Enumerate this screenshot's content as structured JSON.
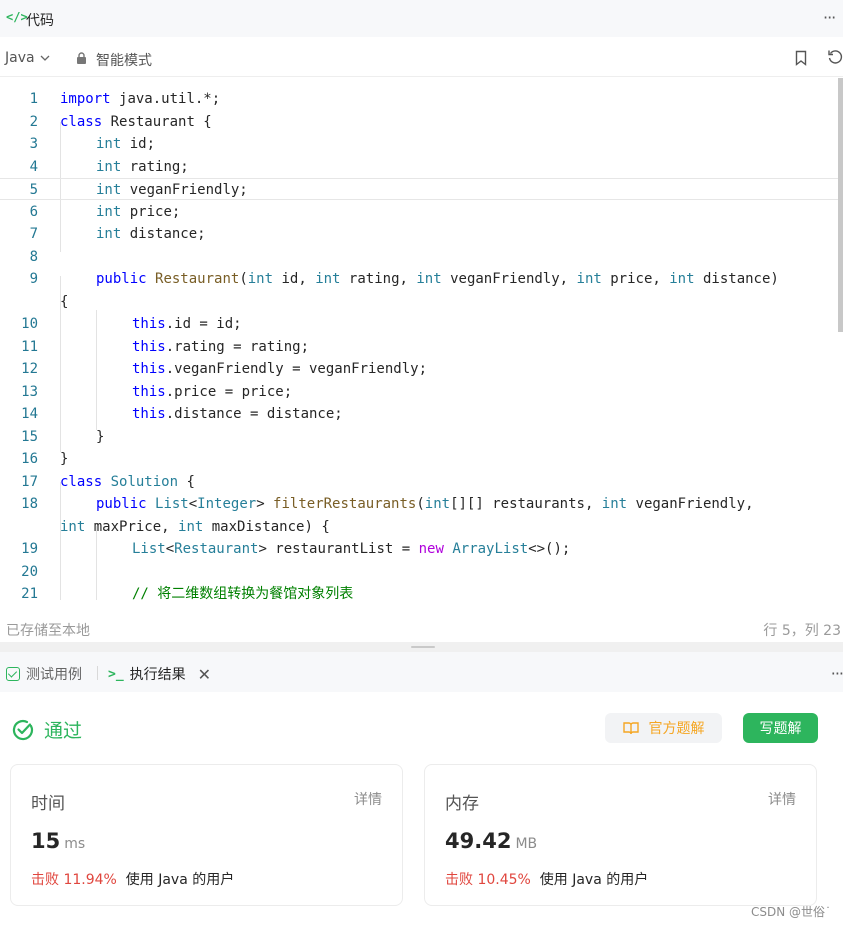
{
  "header": {
    "tab_icon": "</>",
    "tab_label": "代码",
    "more": "···"
  },
  "toolbar": {
    "language": "Java",
    "mode": "智能模式"
  },
  "code": {
    "lines": [
      {
        "n": "1",
        "indent": 0,
        "parts": [
          [
            "kw",
            "import"
          ],
          [
            "",
            "java.util.*;"
          ]
        ]
      },
      {
        "n": "2",
        "indent": 0,
        "parts": [
          [
            "kw",
            "class"
          ],
          [
            "",
            "Restaurant {"
          ]
        ]
      },
      {
        "n": "3",
        "indent": 1,
        "parts": [
          [
            "kt",
            "int"
          ],
          [
            "",
            " id;"
          ]
        ]
      },
      {
        "n": "4",
        "indent": 1,
        "parts": [
          [
            "kt",
            "int"
          ],
          [
            "",
            " rating;"
          ]
        ]
      },
      {
        "n": "5",
        "indent": 1,
        "parts": [
          [
            "kt",
            "int"
          ],
          [
            "",
            " veganFriendly;"
          ]
        ]
      },
      {
        "n": "6",
        "indent": 1,
        "parts": [
          [
            "kt",
            "int"
          ],
          [
            "",
            " price;"
          ]
        ]
      },
      {
        "n": "7",
        "indent": 1,
        "parts": [
          [
            "kt",
            "int"
          ],
          [
            "",
            " distance;"
          ]
        ]
      },
      {
        "n": "8",
        "indent": 0,
        "parts": []
      },
      {
        "n": "9",
        "indent": 1,
        "parts": [
          [
            "kw",
            "public"
          ],
          [
            "",
            " "
          ],
          [
            "fn",
            "Restaurant"
          ],
          [
            "",
            "("
          ],
          [
            "kt",
            "int"
          ],
          [
            "",
            " id, "
          ],
          [
            "kt",
            "int"
          ],
          [
            "",
            " rating, "
          ],
          [
            "kt",
            "int"
          ],
          [
            "",
            " veganFriendly, "
          ],
          [
            "kt",
            "int"
          ],
          [
            "",
            " price, "
          ],
          [
            "kt",
            "int"
          ],
          [
            "",
            " distance)"
          ]
        ]
      },
      {
        "n": "",
        "indent": 0,
        "parts": [
          [
            "",
            "{"
          ]
        ]
      },
      {
        "n": "10",
        "indent": 2,
        "parts": [
          [
            "kw",
            "this"
          ],
          [
            "",
            ".id = id;"
          ]
        ]
      },
      {
        "n": "11",
        "indent": 2,
        "parts": [
          [
            "kw",
            "this"
          ],
          [
            "",
            ".rating = rating;"
          ]
        ]
      },
      {
        "n": "12",
        "indent": 2,
        "parts": [
          [
            "kw",
            "this"
          ],
          [
            "",
            ".veganFriendly = veganFriendly;"
          ]
        ]
      },
      {
        "n": "13",
        "indent": 2,
        "parts": [
          [
            "kw",
            "this"
          ],
          [
            "",
            ".price = price;"
          ]
        ]
      },
      {
        "n": "14",
        "indent": 2,
        "parts": [
          [
            "kw",
            "this"
          ],
          [
            "",
            ".distance = distance;"
          ]
        ]
      },
      {
        "n": "15",
        "indent": 1,
        "parts": [
          [
            "",
            "}"
          ]
        ]
      },
      {
        "n": "16",
        "indent": 0,
        "parts": [
          [
            "",
            "}"
          ]
        ]
      },
      {
        "n": "17",
        "indent": 0,
        "parts": [
          [
            "kw",
            "class"
          ],
          [
            "",
            " "
          ],
          [
            "cls",
            "Solution"
          ],
          [
            "",
            " {"
          ]
        ]
      },
      {
        "n": "18",
        "indent": 1,
        "parts": [
          [
            "kw",
            "public"
          ],
          [
            "",
            " "
          ],
          [
            "cls",
            "List"
          ],
          [
            "",
            "<"
          ],
          [
            "cls",
            "Integer"
          ],
          [
            "",
            "> "
          ],
          [
            "fn",
            "filterRestaurants"
          ],
          [
            "",
            "("
          ],
          [
            "kt",
            "int"
          ],
          [
            "",
            "[][] restaurants, "
          ],
          [
            "kt",
            "int"
          ],
          [
            "",
            " veganFriendly,"
          ]
        ]
      },
      {
        "n": "",
        "indent": 0,
        "parts": [
          [
            "kt",
            "int"
          ],
          [
            "",
            " maxPrice, "
          ],
          [
            "kt",
            "int"
          ],
          [
            "",
            " maxDistance) {"
          ]
        ]
      },
      {
        "n": "19",
        "indent": 2,
        "parts": [
          [
            "cls",
            "List"
          ],
          [
            "",
            "<"
          ],
          [
            "cls",
            "Restaurant"
          ],
          [
            "",
            "> restaurantList = "
          ],
          [
            "new",
            "new"
          ],
          [
            "",
            " "
          ],
          [
            "cls",
            "ArrayList"
          ],
          [
            "",
            "<>();"
          ]
        ]
      },
      {
        "n": "20",
        "indent": 0,
        "parts": []
      },
      {
        "n": "21",
        "indent": 2,
        "parts": [
          [
            "cm",
            "// 将二维数组转换为餐馆对象列表"
          ]
        ]
      }
    ]
  },
  "status": {
    "saved": "已存储至本地",
    "cursor": "行 5，列 23"
  },
  "result_tabs": {
    "test": "测试用例",
    "result": "执行结果"
  },
  "result": {
    "status": "通过",
    "official_solution": "官方题解",
    "write_solution": "写题解",
    "time": {
      "title": "时间",
      "detail": "详情",
      "value": "15",
      "unit": "ms",
      "beat_pct": "击败 11.94%",
      "beat_text": "使用 Java 的用户"
    },
    "memory": {
      "title": "内存",
      "detail": "详情",
      "value": "49.42",
      "unit": "MB",
      "beat_pct": "击败 10.45%",
      "beat_text": "使用 Java 的用户"
    }
  },
  "watermark": "CSDN @世俗˙",
  "colors": {
    "accent": "#2db55d",
    "beat": "#e0463e",
    "official": "#f5a623"
  }
}
